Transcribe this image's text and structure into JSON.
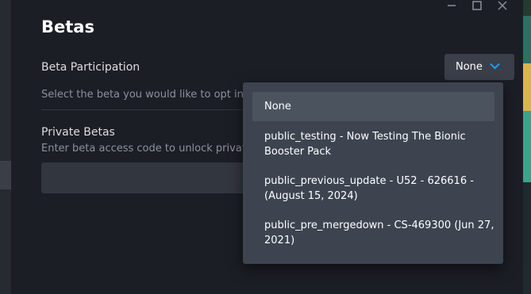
{
  "window": {
    "controls": [
      {
        "name": "minimize",
        "icon": "minimize-icon"
      },
      {
        "name": "maximize",
        "icon": "maximize-icon"
      },
      {
        "name": "close",
        "icon": "close-icon"
      }
    ]
  },
  "page": {
    "title": "Betas"
  },
  "beta_participation": {
    "label": "Beta Participation",
    "selected": "None",
    "hint": "Select the beta you would like to opt into",
    "options": [
      {
        "label": "None",
        "selected": true
      },
      {
        "label": "public_testing - Now Testing The Bionic Booster Pack",
        "selected": false
      },
      {
        "label": "public_previous_update - U52 - 626616 - (August 15, 2024)",
        "selected": false
      },
      {
        "label": "public_pre_mergedown - CS-469300 (Jun 27, 2021)",
        "selected": false
      }
    ]
  },
  "private_betas": {
    "label": "Private Betas",
    "hint": "Enter beta access code to unlock private",
    "input_value": ""
  },
  "colors": {
    "background": "#1b1e25",
    "dropdown": "#3d4450",
    "selected_option": "#4b535f",
    "accent": "#1a9fff"
  }
}
